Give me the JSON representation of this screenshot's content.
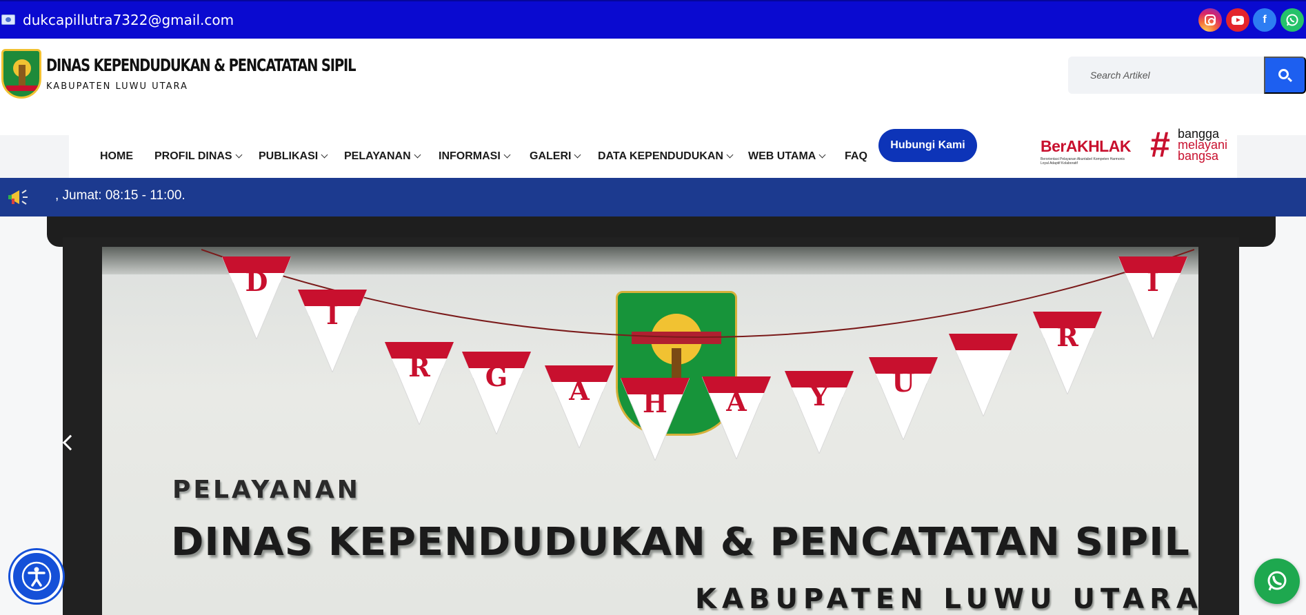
{
  "topbar": {
    "email": "dukcapillutra7322@gmail.com",
    "social": [
      {
        "name": "instagram-icon"
      },
      {
        "name": "youtube-icon"
      },
      {
        "name": "facebook-icon",
        "glyph": "f"
      },
      {
        "name": "whatsapp-icon"
      }
    ]
  },
  "header": {
    "title": "DINAS KEPENDUDUKAN & PENCATATAN SIPIL",
    "subtitle": "KABUPATEN LUWU UTARA",
    "search": {
      "placeholder": "Search Artikel"
    }
  },
  "nav": {
    "items": [
      {
        "label": "HOME"
      },
      {
        "label": "PROFIL DINAS"
      },
      {
        "label": "PUBLIKASI"
      },
      {
        "label": "PELAYANAN"
      },
      {
        "label": "INFORMASI"
      },
      {
        "label": "GALERI"
      },
      {
        "label": "DATA KEPENDUDUKAN"
      },
      {
        "label": "WEB UTAMA"
      },
      {
        "label": "FAQ"
      }
    ],
    "cta": "Hubungi Kami",
    "berakhlak": {
      "title": "BerAKHLAK",
      "tagline": "Berorientasi Pelayanan Akuntabel Kompeten Harmonis Loyal Adaptif Kolaboratif"
    },
    "bangga": {
      "hash": "#",
      "line1": "bangga",
      "line2": "melayani",
      "line3": "bangsa"
    }
  },
  "ticker": {
    "text": ", Jumat: 08:15 - 11:00."
  },
  "slide": {
    "bunting_letters": [
      "D",
      "I",
      "R",
      "G",
      "A",
      "H",
      "A",
      "Y",
      "U",
      "",
      "R",
      "I"
    ],
    "sign_line1": "PELAYANAN",
    "sign_line2": "DINAS KEPENDUDUKAN & PENCATATAN SIPIL",
    "sign_line3": "KABUPATEN LUWU UTARA"
  },
  "colors": {
    "topbar": "#0a0ad0",
    "ticker": "#1c3a8f",
    "cta": "#0d34b8",
    "search_button": "#1d5ff0",
    "bunting_red": "#c8102e",
    "whatsapp": "#1ea84f"
  }
}
